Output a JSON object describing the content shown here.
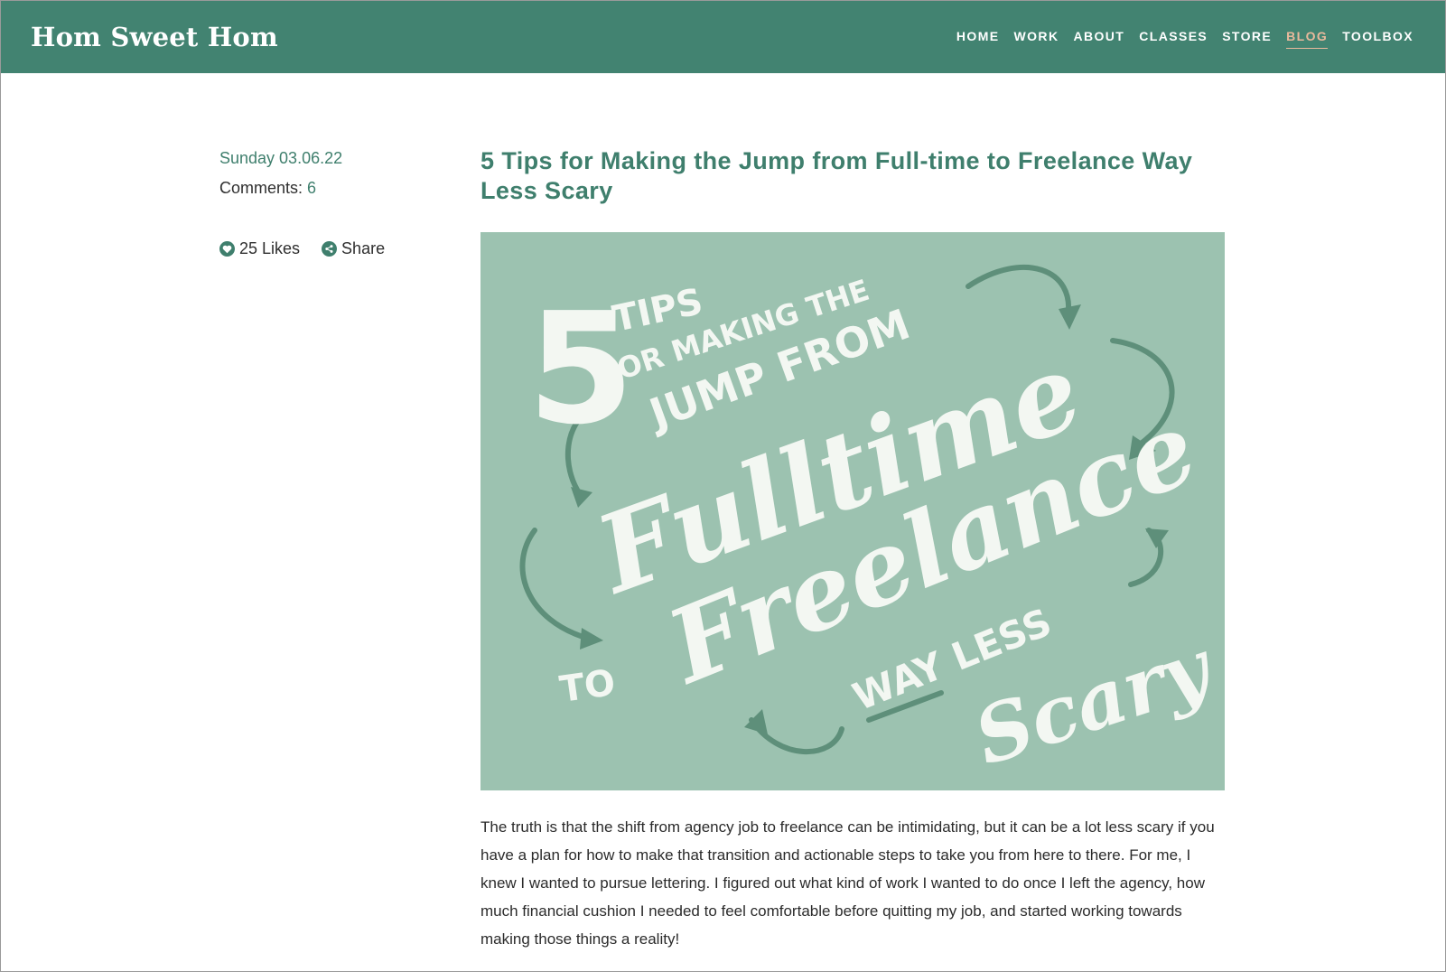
{
  "header": {
    "brand": "Hom Sweet Hom",
    "nav": [
      {
        "label": "HOME",
        "active": false
      },
      {
        "label": "WORK",
        "active": false
      },
      {
        "label": "ABOUT",
        "active": false
      },
      {
        "label": "CLASSES",
        "active": false
      },
      {
        "label": "STORE",
        "active": false
      },
      {
        "label": "BLOG",
        "active": true
      },
      {
        "label": "TOOLBOX",
        "active": false
      }
    ]
  },
  "post": {
    "date": "Sunday 03.06.22",
    "comments_label": "Comments:",
    "comments_count": "6",
    "likes_label": "25 Likes",
    "share_label": "Share",
    "title": "5 Tips for Making the Jump from Full-time to Freelance Way Less Scary",
    "hero_lettering": {
      "number": "5",
      "line1": "TIPS",
      "line2": "FOR MAKING THE",
      "line3": "JUMP FROM",
      "script1": "Fulltime",
      "to": "TO",
      "script2": "Freelance",
      "line4": "WAY LESS",
      "script3": "Scary"
    },
    "body": "The truth is that the shift from agency job to freelance can be intimidating, but it can be a lot less scary if you have a plan for how to make that transition and actionable steps to take you from here to there. For me, I knew I wanted to pursue lettering. I figured out what kind of work I wanted to do once I left the agency, how much financial cushion I needed to feel comfortable before quitting my job, and started working towards making those things a reality!"
  },
  "icons": {
    "likes": "heart-icon",
    "share": "share-icon"
  },
  "colors": {
    "header_bg": "#428371",
    "accent_green": "#3f7f6d",
    "nav_active": "#e9b99c",
    "hero_bg": "#9cc2b0",
    "hero_arrow": "#5e8f7a"
  }
}
